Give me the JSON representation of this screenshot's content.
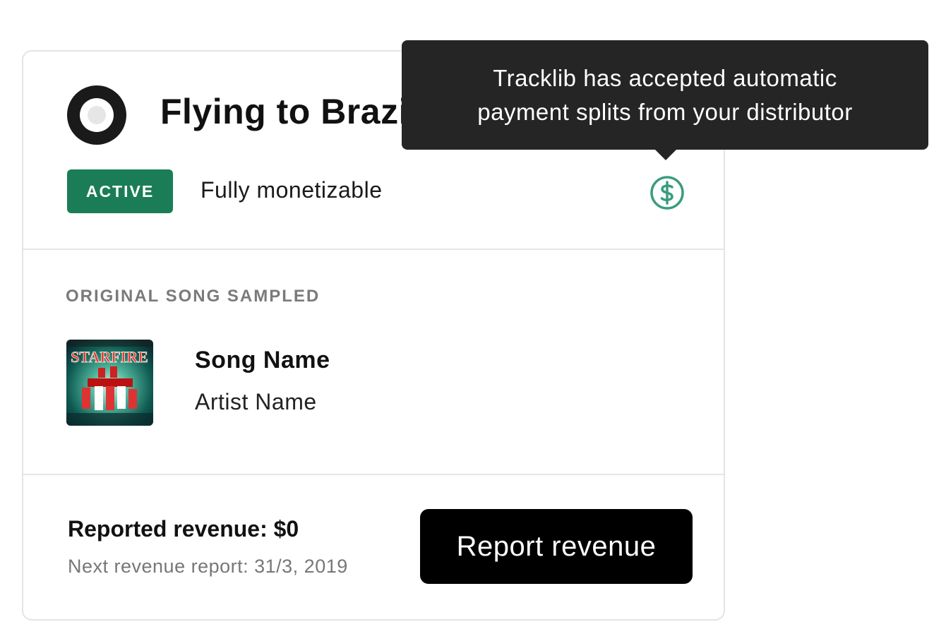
{
  "track": {
    "title": "Flying to Brazil",
    "status_badge": "ACTIVE",
    "monetization": "Fully monetizable"
  },
  "tooltip": {
    "line1": "Tracklib has accepted automatic",
    "line2": "payment splits from your distributor"
  },
  "sample": {
    "section_label": "ORIGINAL SONG SAMPLED",
    "song_name": "Song Name",
    "artist_name": "Artist Name",
    "cover_text": "STARFIRE"
  },
  "revenue": {
    "reported": "Reported revenue: $0",
    "next_report": "Next revenue report: 31/3, 2019",
    "button_label": "Report revenue"
  },
  "colors": {
    "accent_green": "#1b7d57",
    "dollar_icon": "#3a9c7e",
    "tooltip_bg": "#252525",
    "button_bg": "#000000"
  },
  "icons": {
    "record": "vinyl-record-icon",
    "payment": "dollar-circle-icon"
  }
}
